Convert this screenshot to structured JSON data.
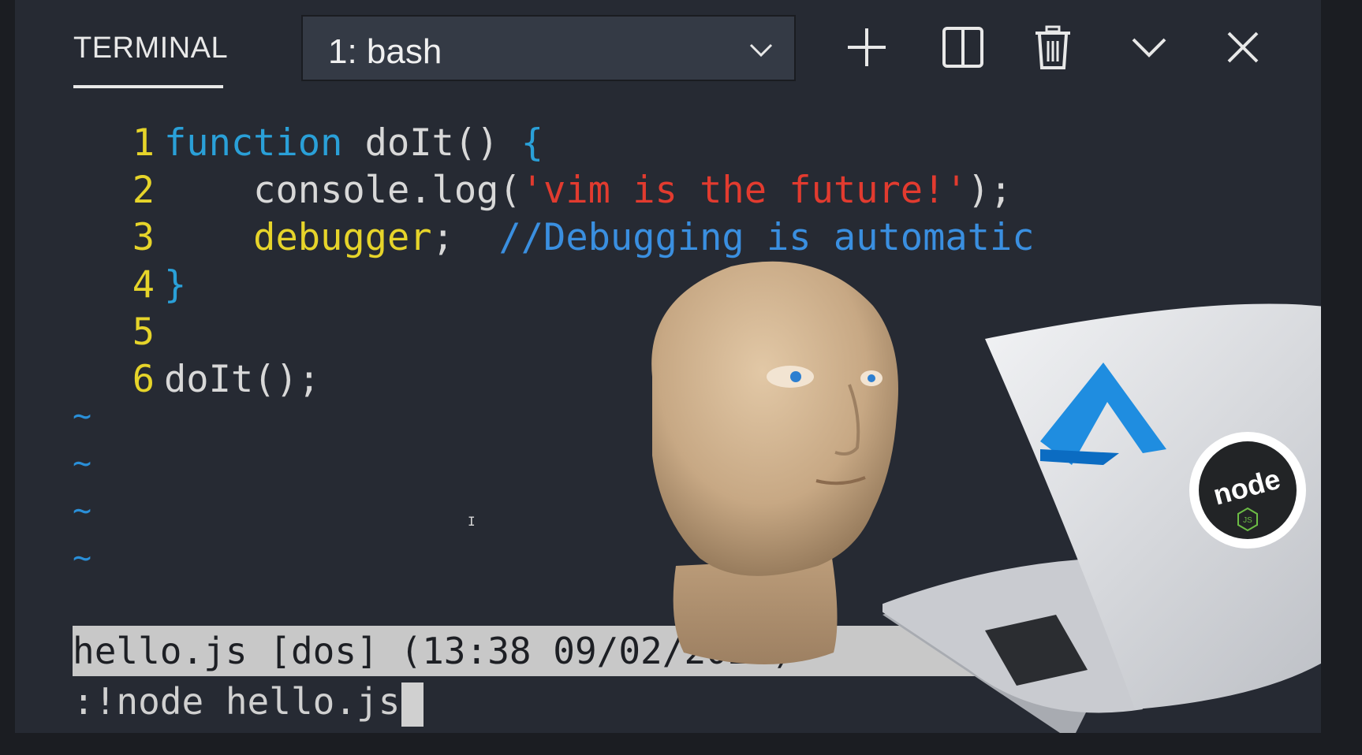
{
  "header": {
    "tab_label": "TERMINAL",
    "terminal_select": "1: bash",
    "tools": [
      "plus-icon",
      "split-icon",
      "trash-icon",
      "chevron-down-icon",
      "close-icon"
    ]
  },
  "editor": {
    "lines": [
      {
        "num": "1",
        "parts": [
          [
            "kw",
            "function"
          ],
          [
            "fn",
            " doIt() "
          ],
          [
            "br",
            "{"
          ]
        ]
      },
      {
        "num": "2",
        "parts": [
          [
            "plain",
            "    console.log("
          ],
          [
            "str",
            "'vim is the future!'"
          ],
          [
            "plain",
            ");"
          ]
        ]
      },
      {
        "num": "3",
        "parts": [
          [
            "yel",
            "    debugger"
          ],
          [
            "plain",
            ";  "
          ],
          [
            "cmt",
            "//Debugging is automatic"
          ]
        ]
      },
      {
        "num": "4",
        "parts": [
          [
            "br",
            "}"
          ]
        ]
      },
      {
        "num": "5",
        "parts": []
      },
      {
        "num": "6",
        "parts": [
          [
            "plain",
            "doIt();"
          ]
        ]
      }
    ],
    "tilde_count": 4,
    "tilde": "~",
    "text_cursor": "I"
  },
  "status_line": "hello.js [dos] (13:38 09/02/2021)",
  "command_line": ":!node hello.js",
  "overlays": {
    "node_badge": "node",
    "node_hex_label": "JS"
  },
  "colors": {
    "keyword": "#2aa0d8",
    "string": "#e23b2f",
    "debugger": "#e6d42a",
    "comment": "#3a8fe0",
    "line_number": "#e6d42a"
  }
}
